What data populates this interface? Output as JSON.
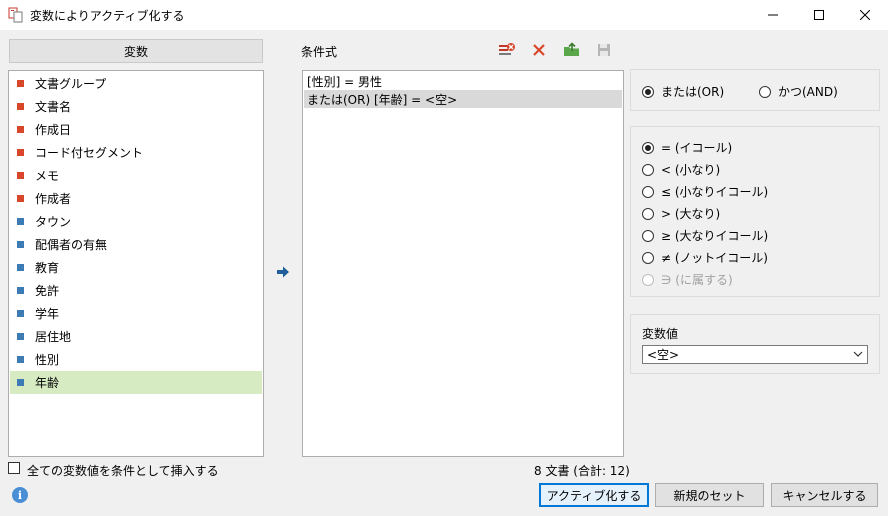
{
  "window": {
    "title": "変数によりアクティブ化する",
    "icon": "documents-icon"
  },
  "variables": {
    "header": "変数",
    "items": [
      {
        "label": "文書グループ",
        "color": "#d9472b"
      },
      {
        "label": "文書名",
        "color": "#d9472b"
      },
      {
        "label": "作成日",
        "color": "#d9472b"
      },
      {
        "label": "コード付セグメント",
        "color": "#d9472b"
      },
      {
        "label": "メモ",
        "color": "#d9472b"
      },
      {
        "label": "作成者",
        "color": "#d9472b"
      },
      {
        "label": "タウン",
        "color": "#3d7bb5"
      },
      {
        "label": "配偶者の有無",
        "color": "#3d7bb5"
      },
      {
        "label": "教育",
        "color": "#3d7bb5"
      },
      {
        "label": "免許",
        "color": "#3d7bb5"
      },
      {
        "label": "学年",
        "color": "#3d7bb5"
      },
      {
        "label": "居住地",
        "color": "#3d7bb5"
      },
      {
        "label": "性別",
        "color": "#3d7bb5"
      },
      {
        "label": "年齢",
        "color": "#3d7bb5",
        "selected": true
      }
    ],
    "insert_all_label": "全ての変数値を条件として挿入する",
    "insert_all_checked": false
  },
  "conditions": {
    "label": "条件式",
    "rows": [
      {
        "text": "[性別] = 男性",
        "selected": false
      },
      {
        "text": "または(OR) [年齢] = <空>",
        "selected": true
      }
    ],
    "doc_count": "8 文書 (合計: 12)"
  },
  "logic": {
    "options": [
      {
        "label": "または(OR)",
        "checked": true
      },
      {
        "label": "かつ(AND)",
        "checked": false
      }
    ]
  },
  "operators": {
    "options": [
      {
        "label": "= (イコール)",
        "checked": true,
        "disabled": false
      },
      {
        "label": "< (小なり)",
        "checked": false,
        "disabled": false
      },
      {
        "label": "≤ (小なりイコール)",
        "checked": false,
        "disabled": false
      },
      {
        "label": "> (大なり)",
        "checked": false,
        "disabled": false
      },
      {
        "label": "≥ (大なりイコール)",
        "checked": false,
        "disabled": false
      },
      {
        "label": "≠ (ノットイコール)",
        "checked": false,
        "disabled": false
      },
      {
        "label": "∋ (に属する)",
        "checked": false,
        "disabled": true
      }
    ]
  },
  "value": {
    "label": "変数値",
    "selected": "<空>"
  },
  "buttons": {
    "activate": "アクティブ化する",
    "new_set": "新規のセット",
    "cancel": "キャンセルする"
  },
  "colors": {
    "accent": "#0078d7",
    "document_var": "#d9472b",
    "user_var": "#3d7bb5",
    "selected_row": "#d6ebc2"
  }
}
